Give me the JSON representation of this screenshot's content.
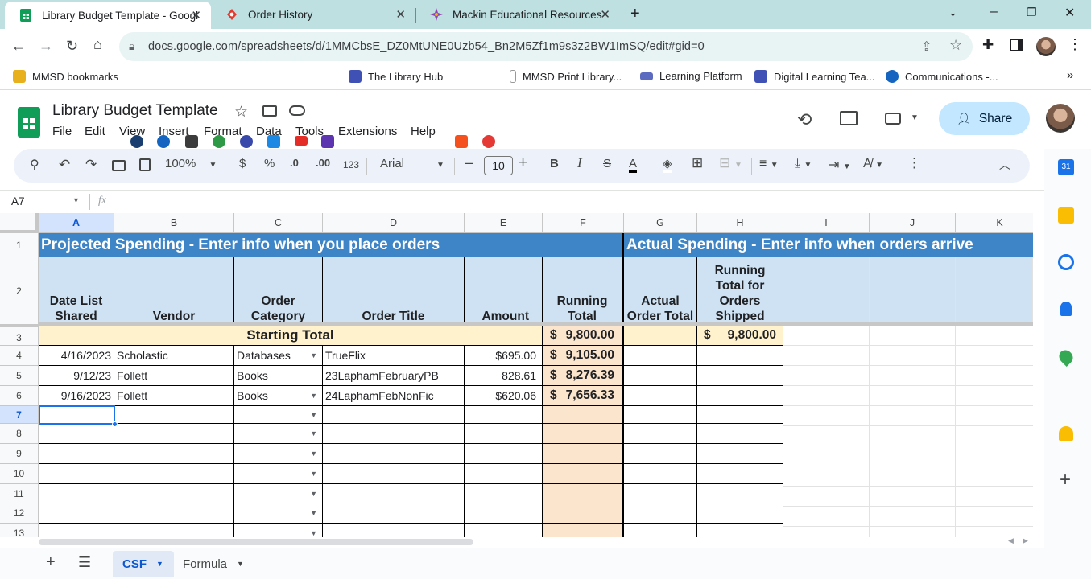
{
  "browser": {
    "tabs": [
      {
        "title": "Library Budget Template - Googl",
        "icon": "sheets-icon"
      },
      {
        "title": "Order History",
        "icon": "order-icon"
      },
      {
        "title": "Mackin Educational Resources",
        "icon": "mackin-icon"
      }
    ],
    "url": "docs.google.com/spreadsheets/d/1MMCbsE_DZ0MtUNE0Uzb54_Bn2M5Zf1m9s3z2BW1ImSQ/edit#gid=0",
    "bookmarks": {
      "b1": "MMSD bookmarks",
      "b2": "The Library Hub",
      "b3": "MMSD Print Library...",
      "b4": "Learning Platform",
      "b5": "Digital Learning Tea...",
      "b6": "Communications -..."
    }
  },
  "doc": {
    "title": "Library Budget Template",
    "menu": {
      "file": "File",
      "edit": "Edit",
      "view": "View",
      "insert": "Insert",
      "format": "Format",
      "data": "Data",
      "tools": "Tools",
      "extensions": "Extensions",
      "help": "Help"
    },
    "share": "Share"
  },
  "toolbar": {
    "zoom": "100%",
    "currency": "$",
    "percent": "%",
    "dec_less": ".0",
    "dec_more": ".00",
    "number_format": "123",
    "font": "Arial",
    "font_size": "10",
    "bold": "B",
    "italic": "I"
  },
  "formula_bar": {
    "cell_ref": "A7",
    "fx": "fx"
  },
  "columns": [
    "A",
    "B",
    "C",
    "D",
    "E",
    "F",
    "G",
    "H",
    "I",
    "J",
    "K"
  ],
  "rows": [
    "1",
    "2",
    "3",
    "4",
    "5",
    "6",
    "7",
    "8",
    "9",
    "10",
    "11",
    "12",
    "13"
  ],
  "sheet": {
    "projected_banner": "Projected Spending - Enter info when you place orders",
    "actual_banner": "Actual Spending - Enter info when orders arrive",
    "headers": {
      "date": "Date List\nShared",
      "vendor": "Vendor",
      "category": "Order\nCategory",
      "title": "Order Title",
      "amount": "Amount",
      "running": "Running\nTotal",
      "actual": "Actual\nOrder Total",
      "shipped": "Running\nTotal for\nOrders\nShipped"
    },
    "starting_label": "Starting Total",
    "start_dollar": "$",
    "start_total": "9,800.00",
    "start_shipped": "9,800.00",
    "data": [
      {
        "date": "4/16/2023",
        "vendor": "Scholastic",
        "category": "Databases",
        "title": "TrueFlix",
        "amount": "$695.00",
        "running": "9,105.00"
      },
      {
        "date": "9/12/23",
        "vendor": "Follett",
        "category": "Books",
        "title": "23LaphamFebruaryPB",
        "amount": "828.61",
        "running": "8,276.39"
      },
      {
        "date": "9/16/2023",
        "vendor": "Follett",
        "category": "Books",
        "title": "24LaphamFebNonFic",
        "amount": "$620.06",
        "running": "7,656.33"
      }
    ]
  },
  "sheet_tabs": {
    "csf": "CSF",
    "formula": "Formula"
  },
  "colors": {
    "banner": "#3d85c6",
    "header": "#cfe2f3",
    "starting": "#fff2cc",
    "running": "#fce5cd"
  }
}
